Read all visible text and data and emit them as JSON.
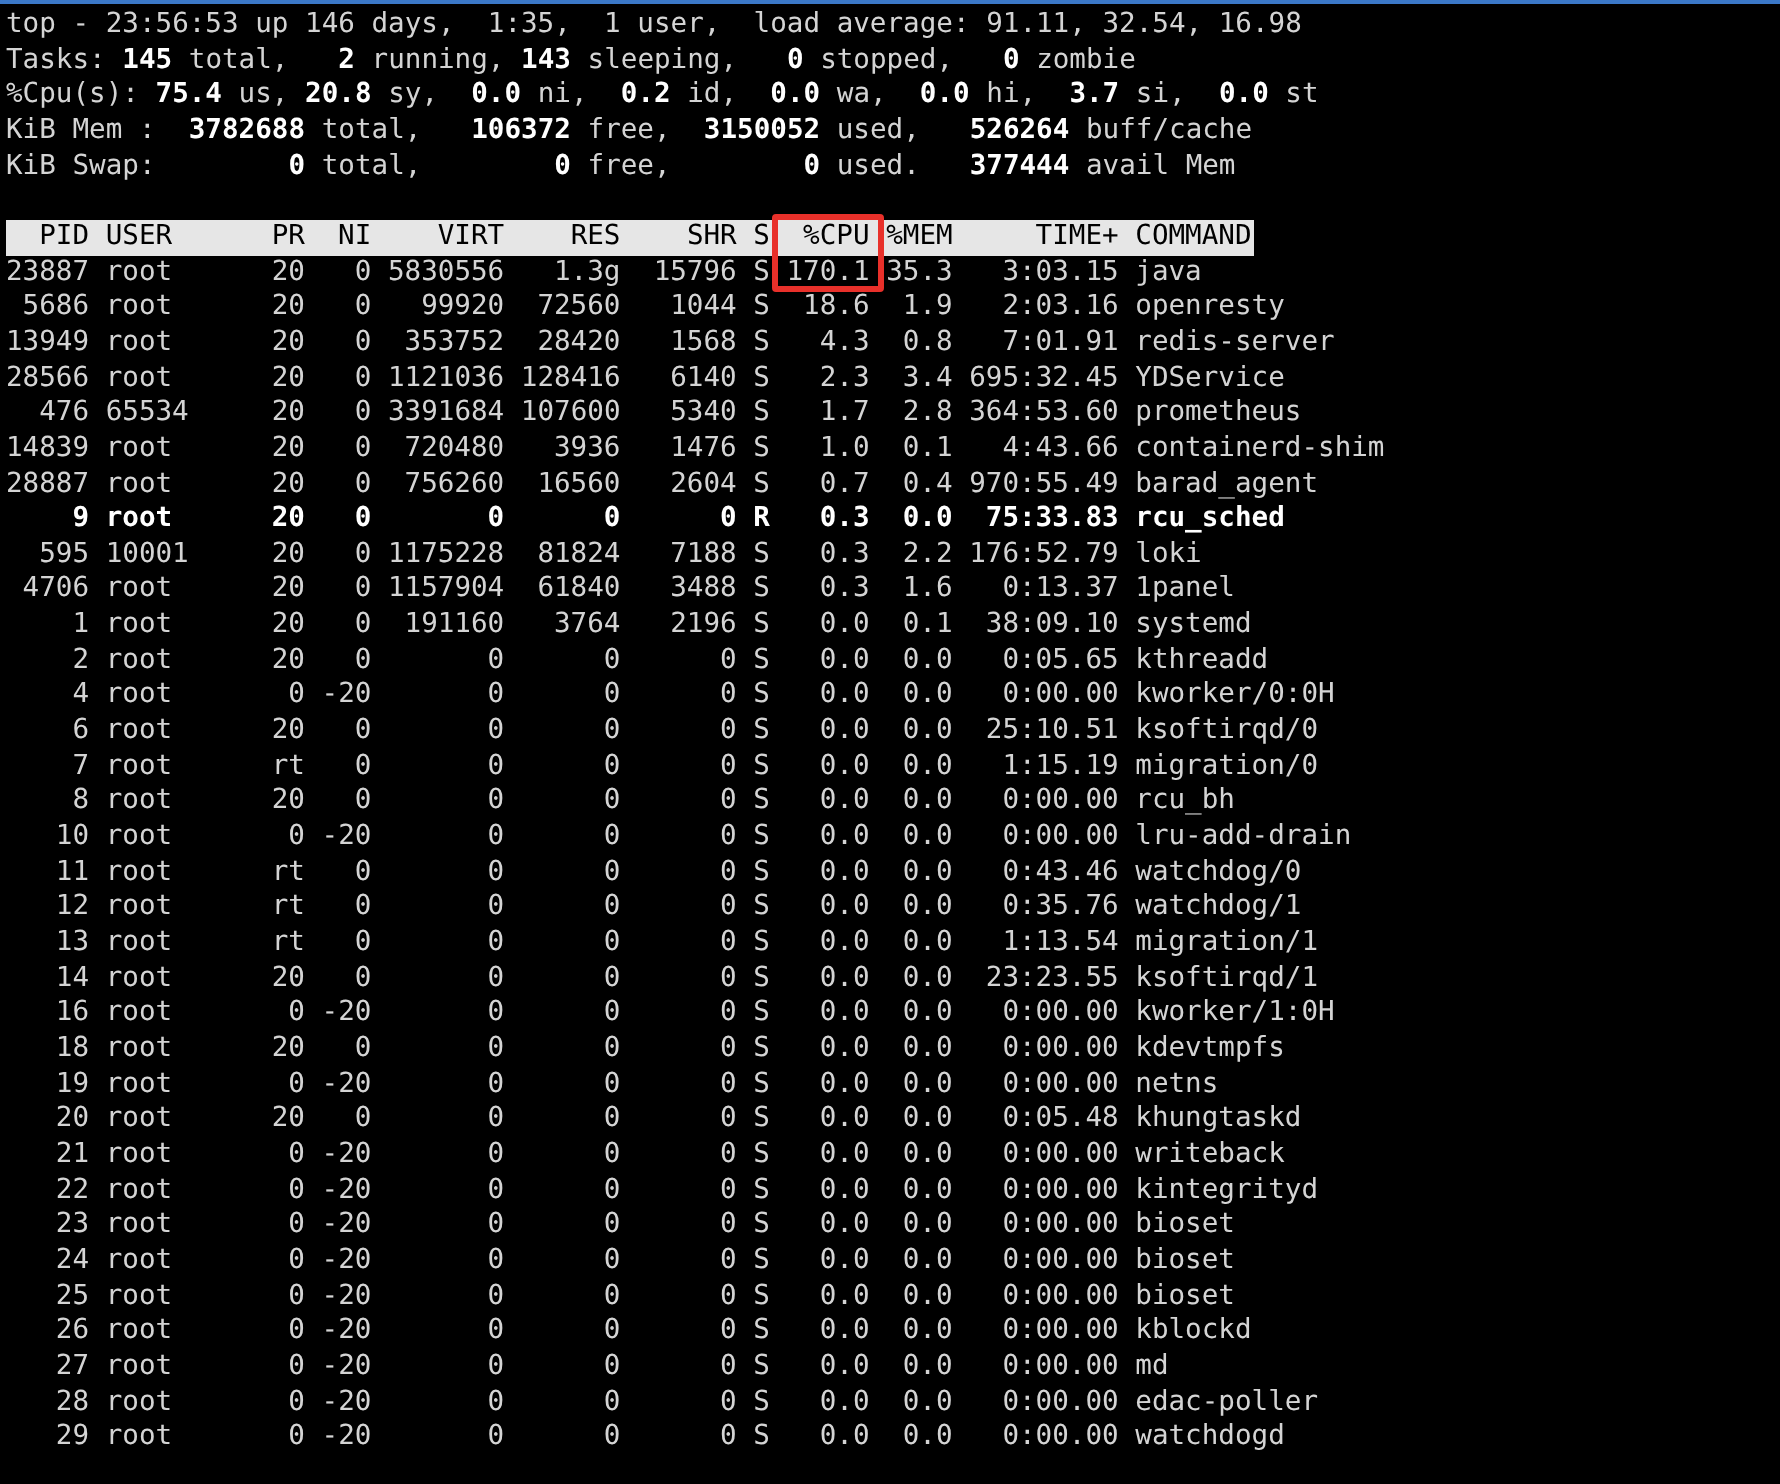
{
  "summary": [
    "top - 23:56:53 up 146 days,  1:35,  1 user,  load average: 91.11, 32.54, 16.98",
    "Tasks: **145** total,   **2** running, **143** sleeping,   **0** stopped,   **0** zombie",
    "%Cpu(s): **75.4** us, **20.8** sy,  **0.0** ni,  **0.2** id,  **0.0** wa,  **0.0** hi,  **3.7** si,  **0.0** st",
    "KiB Mem :  **3782688** total,   **106372** free,  **3150052** used,   **526264** buff/cache",
    "KiB Swap:        **0** total,        **0** free,        **0** used.   **377444** avail Mem"
  ],
  "columns": [
    {
      "label": "PID",
      "highlighted": false
    },
    {
      "label": "USER",
      "highlighted": false
    },
    {
      "label": "PR",
      "highlighted": false
    },
    {
      "label": "NI",
      "highlighted": false
    },
    {
      "label": "VIRT",
      "highlighted": false
    },
    {
      "label": "RES",
      "highlighted": false
    },
    {
      "label": "SHR",
      "highlighted": false
    },
    {
      "label": "S",
      "highlighted": false
    },
    {
      "label": "%CPU",
      "highlighted": true
    },
    {
      "label": "%MEM",
      "highlighted": false
    },
    {
      "label": "TIME+",
      "highlighted": false
    },
    {
      "label": "COMMAND",
      "highlighted": false
    }
  ],
  "rows": [
    {
      "bold": false,
      "pid": "23887",
      "user": "root",
      "pr": "20",
      "ni": "0",
      "virt": "5830556",
      "res": "1.3g",
      "shr": "15796",
      "s": "S",
      "cpu": "170.1",
      "mem": "35.3",
      "time": "3:03.15",
      "command": "java"
    },
    {
      "bold": false,
      "pid": "5686",
      "user": "root",
      "pr": "20",
      "ni": "0",
      "virt": "99920",
      "res": "72560",
      "shr": "1044",
      "s": "S",
      "cpu": "18.6",
      "mem": "1.9",
      "time": "2:03.16",
      "command": "openresty"
    },
    {
      "bold": false,
      "pid": "13949",
      "user": "root",
      "pr": "20",
      "ni": "0",
      "virt": "353752",
      "res": "28420",
      "shr": "1568",
      "s": "S",
      "cpu": "4.3",
      "mem": "0.8",
      "time": "7:01.91",
      "command": "redis-server"
    },
    {
      "bold": false,
      "pid": "28566",
      "user": "root",
      "pr": "20",
      "ni": "0",
      "virt": "1121036",
      "res": "128416",
      "shr": "6140",
      "s": "S",
      "cpu": "2.3",
      "mem": "3.4",
      "time": "695:32.45",
      "command": "YDService"
    },
    {
      "bold": false,
      "pid": "476",
      "user": "65534",
      "pr": "20",
      "ni": "0",
      "virt": "3391684",
      "res": "107600",
      "shr": "5340",
      "s": "S",
      "cpu": "1.7",
      "mem": "2.8",
      "time": "364:53.60",
      "command": "prometheus"
    },
    {
      "bold": false,
      "pid": "14839",
      "user": "root",
      "pr": "20",
      "ni": "0",
      "virt": "720480",
      "res": "3936",
      "shr": "1476",
      "s": "S",
      "cpu": "1.0",
      "mem": "0.1",
      "time": "4:43.66",
      "command": "containerd-shim"
    },
    {
      "bold": false,
      "pid": "28887",
      "user": "root",
      "pr": "20",
      "ni": "0",
      "virt": "756260",
      "res": "16560",
      "shr": "2604",
      "s": "S",
      "cpu": "0.7",
      "mem": "0.4",
      "time": "970:55.49",
      "command": "barad_agent"
    },
    {
      "bold": true,
      "pid": "9",
      "user": "root",
      "pr": "20",
      "ni": "0",
      "virt": "0",
      "res": "0",
      "shr": "0",
      "s": "R",
      "cpu": "0.3",
      "mem": "0.0",
      "time": "75:33.83",
      "command": "rcu_sched"
    },
    {
      "bold": false,
      "pid": "595",
      "user": "10001",
      "pr": "20",
      "ni": "0",
      "virt": "1175228",
      "res": "81824",
      "shr": "7188",
      "s": "S",
      "cpu": "0.3",
      "mem": "2.2",
      "time": "176:52.79",
      "command": "loki"
    },
    {
      "bold": false,
      "pid": "4706",
      "user": "root",
      "pr": "20",
      "ni": "0",
      "virt": "1157904",
      "res": "61840",
      "shr": "3488",
      "s": "S",
      "cpu": "0.3",
      "mem": "1.6",
      "time": "0:13.37",
      "command": "1panel"
    },
    {
      "bold": false,
      "pid": "1",
      "user": "root",
      "pr": "20",
      "ni": "0",
      "virt": "191160",
      "res": "3764",
      "shr": "2196",
      "s": "S",
      "cpu": "0.0",
      "mem": "0.1",
      "time": "38:09.10",
      "command": "systemd"
    },
    {
      "bold": false,
      "pid": "2",
      "user": "root",
      "pr": "20",
      "ni": "0",
      "virt": "0",
      "res": "0",
      "shr": "0",
      "s": "S",
      "cpu": "0.0",
      "mem": "0.0",
      "time": "0:05.65",
      "command": "kthreadd"
    },
    {
      "bold": false,
      "pid": "4",
      "user": "root",
      "pr": "0",
      "ni": "-20",
      "virt": "0",
      "res": "0",
      "shr": "0",
      "s": "S",
      "cpu": "0.0",
      "mem": "0.0",
      "time": "0:00.00",
      "command": "kworker/0:0H"
    },
    {
      "bold": false,
      "pid": "6",
      "user": "root",
      "pr": "20",
      "ni": "0",
      "virt": "0",
      "res": "0",
      "shr": "0",
      "s": "S",
      "cpu": "0.0",
      "mem": "0.0",
      "time": "25:10.51",
      "command": "ksoftirqd/0"
    },
    {
      "bold": false,
      "pid": "7",
      "user": "root",
      "pr": "rt",
      "ni": "0",
      "virt": "0",
      "res": "0",
      "shr": "0",
      "s": "S",
      "cpu": "0.0",
      "mem": "0.0",
      "time": "1:15.19",
      "command": "migration/0"
    },
    {
      "bold": false,
      "pid": "8",
      "user": "root",
      "pr": "20",
      "ni": "0",
      "virt": "0",
      "res": "0",
      "shr": "0",
      "s": "S",
      "cpu": "0.0",
      "mem": "0.0",
      "time": "0:00.00",
      "command": "rcu_bh"
    },
    {
      "bold": false,
      "pid": "10",
      "user": "root",
      "pr": "0",
      "ni": "-20",
      "virt": "0",
      "res": "0",
      "shr": "0",
      "s": "S",
      "cpu": "0.0",
      "mem": "0.0",
      "time": "0:00.00",
      "command": "lru-add-drain"
    },
    {
      "bold": false,
      "pid": "11",
      "user": "root",
      "pr": "rt",
      "ni": "0",
      "virt": "0",
      "res": "0",
      "shr": "0",
      "s": "S",
      "cpu": "0.0",
      "mem": "0.0",
      "time": "0:43.46",
      "command": "watchdog/0"
    },
    {
      "bold": false,
      "pid": "12",
      "user": "root",
      "pr": "rt",
      "ni": "0",
      "virt": "0",
      "res": "0",
      "shr": "0",
      "s": "S",
      "cpu": "0.0",
      "mem": "0.0",
      "time": "0:35.76",
      "command": "watchdog/1"
    },
    {
      "bold": false,
      "pid": "13",
      "user": "root",
      "pr": "rt",
      "ni": "0",
      "virt": "0",
      "res": "0",
      "shr": "0",
      "s": "S",
      "cpu": "0.0",
      "mem": "0.0",
      "time": "1:13.54",
      "command": "migration/1"
    },
    {
      "bold": false,
      "pid": "14",
      "user": "root",
      "pr": "20",
      "ni": "0",
      "virt": "0",
      "res": "0",
      "shr": "0",
      "s": "S",
      "cpu": "0.0",
      "mem": "0.0",
      "time": "23:23.55",
      "command": "ksoftirqd/1"
    },
    {
      "bold": false,
      "pid": "16",
      "user": "root",
      "pr": "0",
      "ni": "-20",
      "virt": "0",
      "res": "0",
      "shr": "0",
      "s": "S",
      "cpu": "0.0",
      "mem": "0.0",
      "time": "0:00.00",
      "command": "kworker/1:0H"
    },
    {
      "bold": false,
      "pid": "18",
      "user": "root",
      "pr": "20",
      "ni": "0",
      "virt": "0",
      "res": "0",
      "shr": "0",
      "s": "S",
      "cpu": "0.0",
      "mem": "0.0",
      "time": "0:00.00",
      "command": "kdevtmpfs"
    },
    {
      "bold": false,
      "pid": "19",
      "user": "root",
      "pr": "0",
      "ni": "-20",
      "virt": "0",
      "res": "0",
      "shr": "0",
      "s": "S",
      "cpu": "0.0",
      "mem": "0.0",
      "time": "0:00.00",
      "command": "netns"
    },
    {
      "bold": false,
      "pid": "20",
      "user": "root",
      "pr": "20",
      "ni": "0",
      "virt": "0",
      "res": "0",
      "shr": "0",
      "s": "S",
      "cpu": "0.0",
      "mem": "0.0",
      "time": "0:05.48",
      "command": "khungtaskd"
    },
    {
      "bold": false,
      "pid": "21",
      "user": "root",
      "pr": "0",
      "ni": "-20",
      "virt": "0",
      "res": "0",
      "shr": "0",
      "s": "S",
      "cpu": "0.0",
      "mem": "0.0",
      "time": "0:00.00",
      "command": "writeback"
    },
    {
      "bold": false,
      "pid": "22",
      "user": "root",
      "pr": "0",
      "ni": "-20",
      "virt": "0",
      "res": "0",
      "shr": "0",
      "s": "S",
      "cpu": "0.0",
      "mem": "0.0",
      "time": "0:00.00",
      "command": "kintegrityd"
    },
    {
      "bold": false,
      "pid": "23",
      "user": "root",
      "pr": "0",
      "ni": "-20",
      "virt": "0",
      "res": "0",
      "shr": "0",
      "s": "S",
      "cpu": "0.0",
      "mem": "0.0",
      "time": "0:00.00",
      "command": "bioset"
    },
    {
      "bold": false,
      "pid": "24",
      "user": "root",
      "pr": "0",
      "ni": "-20",
      "virt": "0",
      "res": "0",
      "shr": "0",
      "s": "S",
      "cpu": "0.0",
      "mem": "0.0",
      "time": "0:00.00",
      "command": "bioset"
    },
    {
      "bold": false,
      "pid": "25",
      "user": "root",
      "pr": "0",
      "ni": "-20",
      "virt": "0",
      "res": "0",
      "shr": "0",
      "s": "S",
      "cpu": "0.0",
      "mem": "0.0",
      "time": "0:00.00",
      "command": "bioset"
    },
    {
      "bold": false,
      "pid": "26",
      "user": "root",
      "pr": "0",
      "ni": "-20",
      "virt": "0",
      "res": "0",
      "shr": "0",
      "s": "S",
      "cpu": "0.0",
      "mem": "0.0",
      "time": "0:00.00",
      "command": "kblockd"
    },
    {
      "bold": false,
      "pid": "27",
      "user": "root",
      "pr": "0",
      "ni": "-20",
      "virt": "0",
      "res": "0",
      "shr": "0",
      "s": "S",
      "cpu": "0.0",
      "mem": "0.0",
      "time": "0:00.00",
      "command": "md"
    },
    {
      "bold": false,
      "pid": "28",
      "user": "root",
      "pr": "0",
      "ni": "-20",
      "virt": "0",
      "res": "0",
      "shr": "0",
      "s": "S",
      "cpu": "0.0",
      "mem": "0.0",
      "time": "0:00.00",
      "command": "edac-poller"
    },
    {
      "bold": false,
      "pid": "29",
      "user": "root",
      "pr": "0",
      "ni": "-20",
      "virt": "0",
      "res": "0",
      "shr": "0",
      "s": "S",
      "cpu": "0.0",
      "mem": "0.0",
      "time": "0:00.00",
      "command": "watchdogd"
    }
  ]
}
